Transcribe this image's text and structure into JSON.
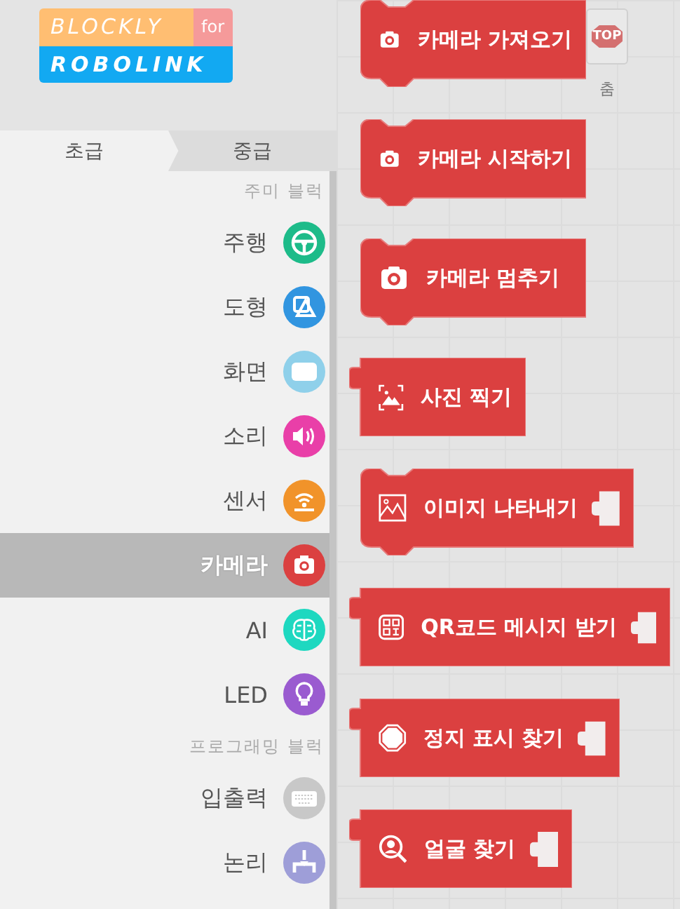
{
  "logo": {
    "top": "BLOCKLY",
    "tag": "for",
    "bottom": "ROBOLINK"
  },
  "level_tabs": [
    {
      "label": "초급",
      "selected": true
    },
    {
      "label": "중급",
      "selected": false
    }
  ],
  "toolbox": [
    {
      "kind": "header",
      "label": "주미 블럭"
    },
    {
      "kind": "category",
      "label": "주행",
      "color": "#1dbb89",
      "selected": false
    },
    {
      "kind": "category",
      "label": "도형",
      "color": "#3195e0",
      "selected": false
    },
    {
      "kind": "category",
      "label": "화면",
      "color": "#8fd0ea",
      "selected": false
    },
    {
      "kind": "category",
      "label": "소리",
      "color": "#e93fa8",
      "selected": false
    },
    {
      "kind": "category",
      "label": "센서",
      "color": "#f1932a",
      "selected": false
    },
    {
      "kind": "category",
      "label": "카메라",
      "color": "#db4040",
      "selected": true
    },
    {
      "kind": "category",
      "label": "AI",
      "color": "#1ed8c0",
      "selected": false
    },
    {
      "kind": "category",
      "label": "LED",
      "color": "#9a5bd0",
      "selected": false
    },
    {
      "kind": "header",
      "label": "프로그래밍 블럭"
    },
    {
      "kind": "category",
      "label": "입출력",
      "color": "#c8c8c8",
      "selected": false
    },
    {
      "kind": "category",
      "label": "논리",
      "color": "#9e9ed8",
      "selected": false
    }
  ],
  "hidden_stop_button": {
    "sign": "TOP",
    "label": "춤"
  },
  "blocks": [
    {
      "kind": "statement",
      "label": "카메라 가져오기",
      "input_socket": false
    },
    {
      "kind": "statement",
      "label": "카메라 시작하기",
      "input_socket": false
    },
    {
      "kind": "statement",
      "label": "카메라 멈추기",
      "input_socket": false
    },
    {
      "kind": "output",
      "label": "사진 찍기",
      "input_socket": false
    },
    {
      "kind": "statement",
      "label": "이미지 나타내기",
      "input_socket": true
    },
    {
      "kind": "output",
      "label": "QR코드 메시지 받기",
      "input_socket": true
    },
    {
      "kind": "output",
      "label": "정지 표시 찾기",
      "input_socket": true
    },
    {
      "kind": "output",
      "label": "얼굴 찾기",
      "input_socket": true
    }
  ]
}
